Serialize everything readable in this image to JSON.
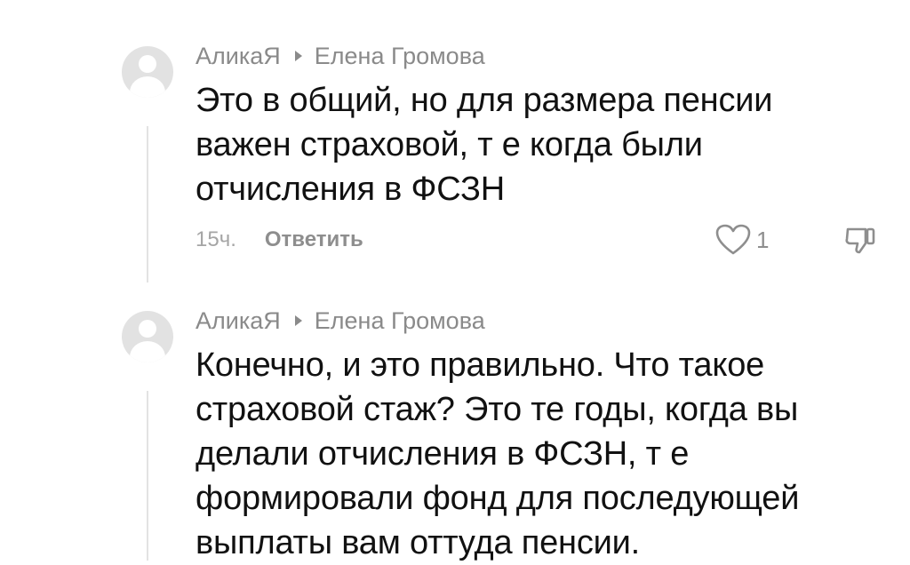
{
  "comments": [
    {
      "author": "АликаЯ",
      "reply_to": "Елена Громова",
      "text_lines": [
        "Это в общий, но для размера пенсии",
        "важен страховой, т е когда были",
        "отчисления в ФСЗН"
      ],
      "time": "15ч.",
      "reply_label": "Ответить",
      "likes": "1",
      "icons": {
        "avatar": "default-avatar-icon",
        "caret": "caret-right-icon",
        "like": "heart-outline-icon",
        "dislike": "thumbs-down-outline-icon"
      }
    },
    {
      "author": "АликаЯ",
      "reply_to": "Елена Громова",
      "text_lines": [
        "Конечно, и это правильно. Что такое",
        "страховой стаж? Это те годы, когда вы",
        "делали отчисления в ФСЗН, т е",
        "формировали фонд для последующей",
        "выплаты вам оттуда пенсии."
      ],
      "icons": {
        "avatar": "default-avatar-icon",
        "caret": "caret-right-icon"
      }
    }
  ],
  "colors": {
    "secondary_text": "#8a8a8a",
    "primary_text": "#111111",
    "avatar_bg": "#e2e2e2"
  }
}
